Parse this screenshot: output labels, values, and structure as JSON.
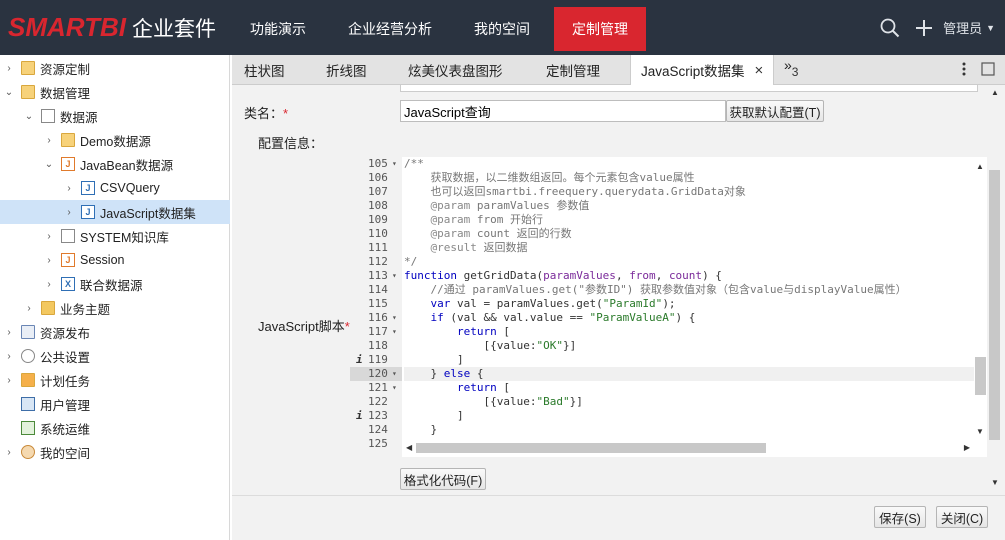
{
  "app": {
    "logo_text": "SMARTBI",
    "logo_suite": "企业套件"
  },
  "nav": {
    "items": [
      {
        "label": "功能演示"
      },
      {
        "label": "企业经营分析"
      },
      {
        "label": "我的空间"
      },
      {
        "label": "定制管理"
      }
    ],
    "active": "定制管理",
    "user": "管理员"
  },
  "sidebar": {
    "items": [
      {
        "label": "资源定制"
      },
      {
        "label": "数据管理"
      },
      {
        "label": "数据源"
      },
      {
        "label": "Demo数据源"
      },
      {
        "label": "JavaBean数据源"
      },
      {
        "label": "CSVQuery"
      },
      {
        "label": "JavaScript数据集"
      },
      {
        "label": "SYSTEM知识库"
      },
      {
        "label": "Session"
      },
      {
        "label": "联合数据源"
      },
      {
        "label": "业务主题"
      },
      {
        "label": "资源发布"
      },
      {
        "label": "公共设置"
      },
      {
        "label": "计划任务"
      },
      {
        "label": "用户管理"
      },
      {
        "label": "系统运维"
      },
      {
        "label": "我的空间"
      }
    ],
    "icon_j": "J",
    "icon_x": "X"
  },
  "tabs": {
    "items": [
      {
        "label": "柱状图"
      },
      {
        "label": "折线图"
      },
      {
        "label": "炫美仪表盘图形"
      },
      {
        "label": "定制管理"
      },
      {
        "label": "JavaScript数据集"
      }
    ],
    "overflow": "»",
    "overflow_count": "3",
    "close": "×"
  },
  "form": {
    "name_label": "类名：",
    "required": "*",
    "name_value": "JavaScript查询",
    "default_config_button": "获取默认配置(T)",
    "config_label": "配置信息：",
    "script_label": "JavaScript脚本",
    "format_button": "格式化代码(F)",
    "save_button": "保存(S)",
    "close_button": "关闭(C)"
  },
  "code": {
    "line_numbers": [
      "105",
      "106",
      "107",
      "108",
      "109",
      "110",
      "111",
      "112",
      "113",
      "114",
      "115",
      "116",
      "117",
      "118",
      "119",
      "120",
      "121",
      "122",
      "123",
      "124",
      "125"
    ],
    "lines": [
      "/**",
      "    获取数据，以二维数组返回。每个元素包含value属性",
      "    也可以返回smartbi.freequery.querydata.GridData对象",
      "    @param paramValues 参数值",
      "    @param from 开始行",
      "    @param count 返回的行数",
      "    @result 返回数据",
      "*/",
      "function getGridData(paramValues, from, count) {",
      "    //通过 paramValues.get(\"参数ID\") 获取参数值对象（包含value与displayValue属性）",
      "    var val = paramValues.get(\"ParamId\");",
      "    if (val && val.value == \"ParamValueA\") {",
      "        return [",
      "            [{value:\"OK\"}]",
      "        ]",
      "    } else {",
      "        return [",
      "            [{value:\"Bad\"}]",
      "        ]",
      "    }",
      ""
    ],
    "info_marker": "i",
    "fold_marker": "▾"
  },
  "colors": {
    "topbar": "#2a3340",
    "brand_red": "#d9262f",
    "selected_row": "#cfe3f8",
    "keyword": "#0000c0",
    "comment": "#777777",
    "string": "#2a7a2a",
    "param": "#7a2a9a"
  }
}
